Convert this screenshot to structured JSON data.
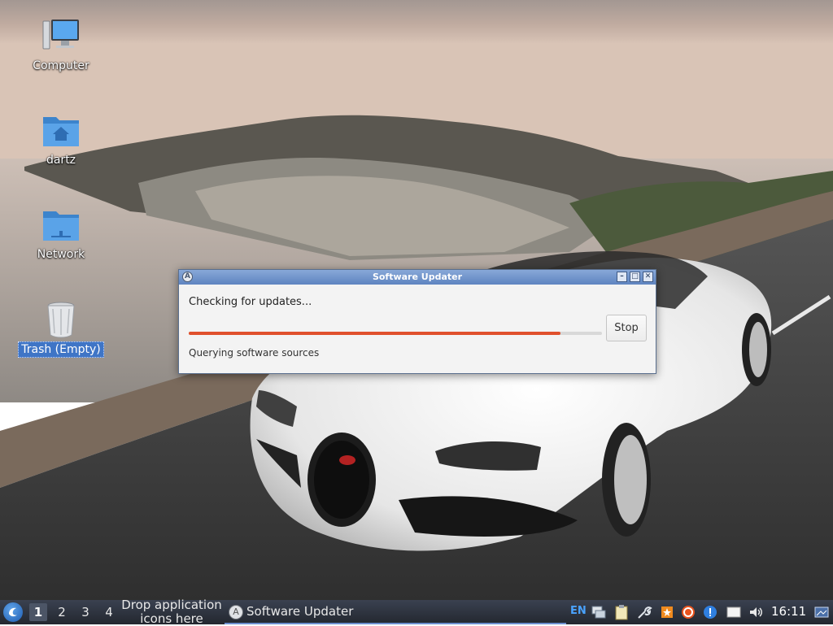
{
  "desktop": {
    "icons": [
      {
        "label": "Computer",
        "glyph": "computer-icon"
      },
      {
        "label": "dartz",
        "glyph": "home-folder-icon"
      },
      {
        "label": "Network",
        "glyph": "network-folder-icon"
      },
      {
        "label": "Trash (Empty)",
        "glyph": "trash-icon",
        "selected": true
      }
    ]
  },
  "dialog": {
    "title": "Software Updater",
    "heading": "Checking for updates...",
    "progress": 0.9,
    "stop_label": "Stop",
    "detail": "Querying software sources",
    "window_controls": [
      "minimize",
      "maximize",
      "close"
    ]
  },
  "taskbar": {
    "workspaces": [
      "1",
      "2",
      "3",
      "4"
    ],
    "active_workspace": "1",
    "drop_hint": "Drop application icons here",
    "task_label": "Software Updater",
    "language": "EN",
    "tray_icons": [
      "network-icon",
      "clipboard-icon",
      "tools-icon",
      "orange-star-icon",
      "update-icon",
      "notification-icon",
      "blank-window-icon",
      "volume-icon"
    ],
    "clock": "16:11",
    "accent_color": "#e0502c"
  }
}
